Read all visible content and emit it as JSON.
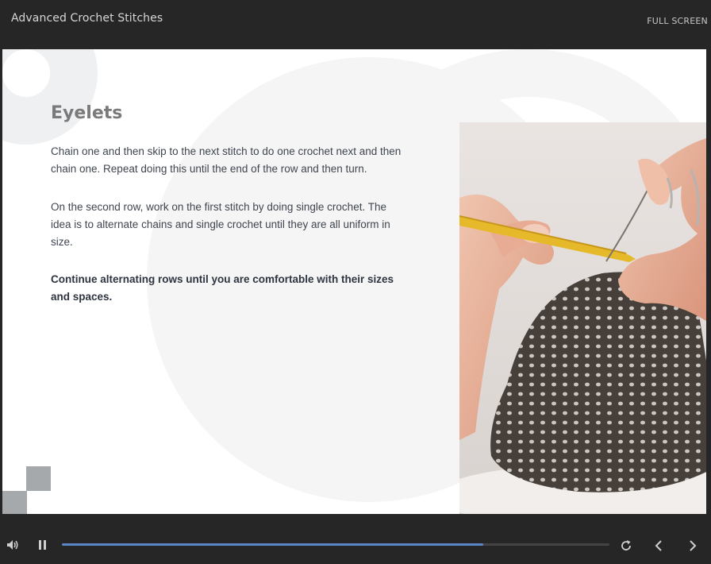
{
  "header": {
    "course_title": "Advanced Crochet Stitches",
    "fullscreen_label": "FULL SCREEN"
  },
  "slide": {
    "heading": "Eyelets",
    "paragraphs": [
      "Chain one and then skip to the next stitch to do one crochet next and then chain one. Repeat doing this until the end of the row and then turn.",
      "On the second row, work on the first stitch by doing single crochet. The idea is to alternate chains and single crochet until they are all uniform in size.",
      "Continue alternating rows until you are comfortable with their sizes and spaces."
    ],
    "image": "hands-crocheting-eyelet-stitch-photo"
  },
  "player": {
    "progress_fraction": 0.77,
    "icons": [
      "volume-icon",
      "pause-icon",
      "replay-icon",
      "chevron-left-icon",
      "chevron-right-icon"
    ],
    "colors": {
      "progress": "#5b87c9",
      "bar_bg": "#262626"
    }
  }
}
